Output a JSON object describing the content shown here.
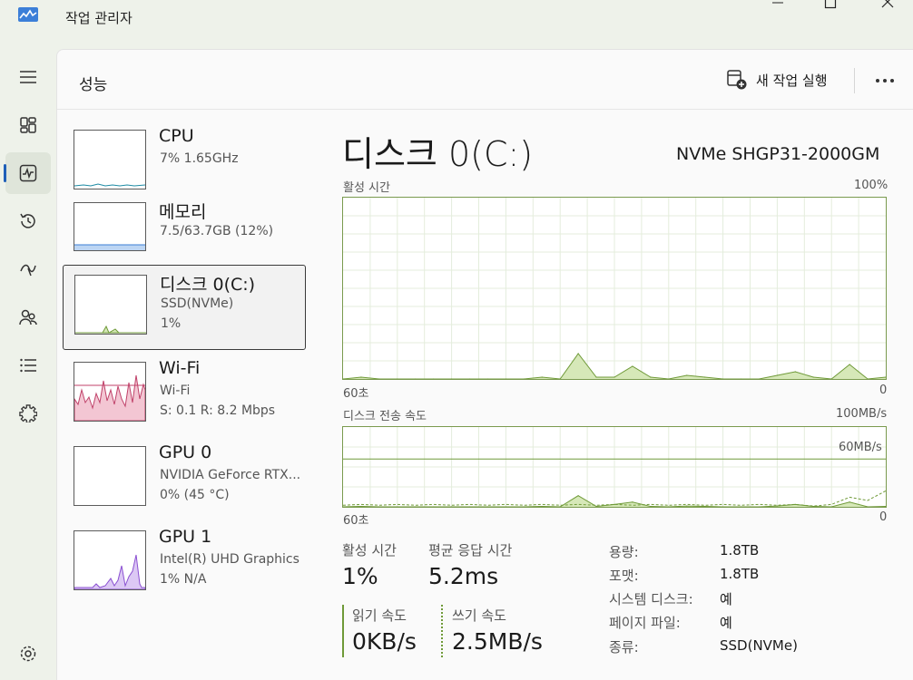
{
  "window": {
    "title": "작업 관리자"
  },
  "header": {
    "page_title": "성능",
    "run_task_label": "새 작업 실행"
  },
  "rail": {
    "items": [
      {
        "icon": "hamburger-icon"
      },
      {
        "icon": "processes-icon"
      },
      {
        "icon": "performance-icon",
        "active": true
      },
      {
        "icon": "app-history-icon"
      },
      {
        "icon": "startup-apps-icon"
      },
      {
        "icon": "users-icon"
      },
      {
        "icon": "details-icon"
      },
      {
        "icon": "services-icon"
      },
      {
        "icon": "settings-icon"
      }
    ]
  },
  "devices": [
    {
      "name": "CPU",
      "sub1": "7%  1.65GHz",
      "sub2": "",
      "color": "#1e8ba4"
    },
    {
      "name": "메모리",
      "sub1": "7.5/63.7GB (12%)",
      "sub2": "",
      "color": "#3b7fd4"
    },
    {
      "name": "디스크 0(C:)",
      "sub1": "SSD(NVMe)",
      "sub2": "1%",
      "color": "#6f9a38",
      "selected": true
    },
    {
      "name": "Wi-Fi",
      "sub1": "Wi-Fi",
      "sub2": "S: 0.1  R: 8.2 Mbps",
      "color": "#c0426a"
    },
    {
      "name": "GPU 0",
      "sub1": "NVIDIA GeForce RTX...",
      "sub2": "0% (45 °C)",
      "color": "#8a4fd1"
    },
    {
      "name": "GPU 1",
      "sub1": "Intel(R) UHD Graphics",
      "sub2": "1%  N/A",
      "color": "#8a4fd1"
    }
  ],
  "detail": {
    "title": "디스크 0(C:)",
    "model": "NVMe SHGP31-2000GM",
    "graph1": {
      "label": "활성 시간",
      "max": "100%",
      "time": "60초",
      "min": "0"
    },
    "graph2": {
      "label": "디스크 전송 속도",
      "max": "100MB/s",
      "mark": "60MB/s",
      "time": "60초",
      "min": "0"
    },
    "stats": {
      "active_label": "활성 시간",
      "active_value": "1%",
      "resp_label": "평균 응답 시간",
      "resp_value": "5.2ms",
      "read_label": "읽기 속도",
      "read_value": "0KB/s",
      "write_label": "쓰기 속도",
      "write_value": "2.5MB/s"
    },
    "props": [
      {
        "label": "용량:",
        "value": "1.8TB"
      },
      {
        "label": "포맷:",
        "value": "1.8TB"
      },
      {
        "label": "시스템 디스크:",
        "value": "예"
      },
      {
        "label": "페이지 파일:",
        "value": "예"
      },
      {
        "label": "종류:",
        "value": "SSD(NVMe)"
      }
    ]
  },
  "chart_data": [
    {
      "type": "area",
      "title": "활성 시간",
      "x": [
        0,
        2,
        4,
        6,
        8,
        10,
        12,
        14,
        16,
        18,
        20,
        22,
        24,
        26,
        28,
        30,
        32,
        34,
        36,
        38,
        40,
        42,
        44,
        46,
        48,
        50,
        52,
        54,
        56,
        58,
        60
      ],
      "values": [
        0,
        1,
        0,
        0,
        0,
        0,
        0,
        0,
        0,
        0,
        0,
        1,
        0,
        14,
        1,
        1,
        7,
        1,
        0,
        2,
        1,
        0,
        0,
        0,
        2,
        4,
        1,
        0,
        8,
        0,
        1
      ],
      "ylim": [
        0,
        100
      ]
    },
    {
      "type": "area",
      "title": "디스크 전송 속도",
      "x": [
        0,
        2,
        4,
        6,
        8,
        10,
        12,
        14,
        16,
        18,
        20,
        22,
        24,
        26,
        28,
        30,
        32,
        34,
        36,
        38,
        40,
        42,
        44,
        46,
        48,
        50,
        52,
        54,
        56,
        58,
        60
      ],
      "series": [
        {
          "values": [
            0,
            0.5,
            0,
            0,
            0,
            0,
            0,
            0,
            0,
            0,
            0,
            0.5,
            0,
            14,
            0.5,
            3,
            6,
            0.5,
            0,
            1,
            0.5,
            0,
            0,
            0,
            1,
            3,
            0.5,
            0,
            6,
            0,
            0.5
          ]
        },
        {
          "values": [
            2,
            3,
            2,
            3,
            2,
            3,
            2,
            3,
            2,
            3,
            2,
            3,
            2,
            3,
            2,
            3,
            2,
            3,
            2,
            3,
            2,
            3,
            2,
            3,
            2,
            3,
            1,
            3,
            12,
            8,
            20
          ]
        }
      ],
      "ylim": [
        0,
        100
      ],
      "marker": 60
    }
  ]
}
